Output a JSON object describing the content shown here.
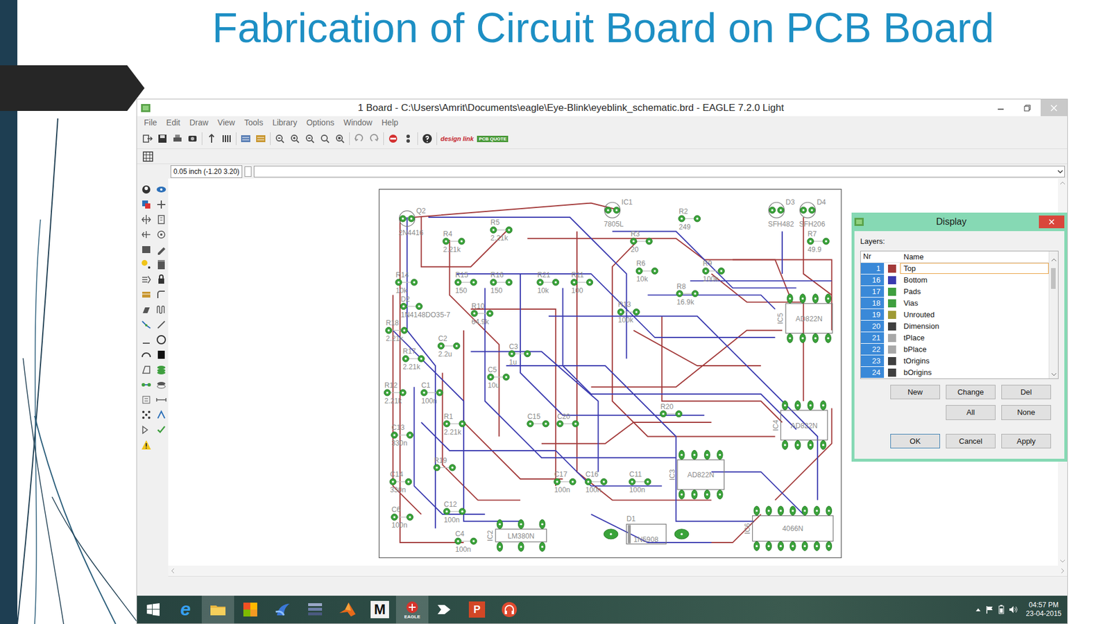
{
  "slide": {
    "title": "Fabrication of Circuit Board on PCB Board"
  },
  "window": {
    "title": "1 Board - C:\\Users\\Amrit\\Documents\\eagle\\Eye-Blink\\eyeblink_schematic.brd - EAGLE 7.2.0 Light"
  },
  "menu": [
    "File",
    "Edit",
    "Draw",
    "View",
    "Tools",
    "Library",
    "Options",
    "Window",
    "Help"
  ],
  "toolbar": {
    "logos": [
      "design link",
      "PCB QUOTE"
    ]
  },
  "command": {
    "coordinates": "0.05 inch (-1.20 3.20)"
  },
  "board": {
    "parts": [
      {
        "name": "Q2",
        "value": "2N4416",
        "kind": "round"
      },
      {
        "name": "IC1",
        "value": "7805L",
        "kind": "round"
      },
      {
        "name": "R2",
        "value": "249",
        "kind": "two-pad"
      },
      {
        "name": "D3",
        "value": "SFH482",
        "kind": "round"
      },
      {
        "name": "D4",
        "value": "SFH206",
        "kind": "round"
      },
      {
        "name": "R4",
        "value": "2.21k",
        "kind": "two-pad"
      },
      {
        "name": "R5",
        "value": "2.21k",
        "kind": "two-pad"
      },
      {
        "name": "R3",
        "value": "20",
        "kind": "two-pad"
      },
      {
        "name": "R7",
        "value": "49.9",
        "kind": "two-pad"
      },
      {
        "name": "R6",
        "value": "10k",
        "kind": "two-pad"
      },
      {
        "name": "R9",
        "value": "100k",
        "kind": "two-pad"
      },
      {
        "name": "R14",
        "value": "10k",
        "kind": "two-pad"
      },
      {
        "name": "R15",
        "value": "150",
        "kind": "two-pad"
      },
      {
        "name": "R16",
        "value": "150",
        "kind": "two-pad"
      },
      {
        "name": "R21",
        "value": "10k",
        "kind": "two-pad"
      },
      {
        "name": "R11",
        "value": "100",
        "kind": "two-pad"
      },
      {
        "name": "D2",
        "value": "1N4148DO35-7",
        "kind": "two-pad"
      },
      {
        "name": "R10",
        "value": "64.9k",
        "kind": "two-pad"
      },
      {
        "name": "R8",
        "value": "16.9k",
        "kind": "two-pad"
      },
      {
        "name": "R13",
        "value": "100k",
        "kind": "two-pad"
      },
      {
        "name": "IC5",
        "value": "AD822N",
        "kind": "dip"
      },
      {
        "name": "R18",
        "value": "2.21k",
        "kind": "two-pad"
      },
      {
        "name": "C2",
        "value": "2.2u",
        "kind": "two-pad"
      },
      {
        "name": "C3",
        "value": "1u",
        "kind": "two-pad"
      },
      {
        "name": "R17",
        "value": "2.21k",
        "kind": "two-pad"
      },
      {
        "name": "C5",
        "value": "10u",
        "kind": "two-pad"
      },
      {
        "name": "R12",
        "value": "2.21k",
        "kind": "two-pad"
      },
      {
        "name": "C1",
        "value": "100n",
        "kind": "two-pad"
      },
      {
        "name": "R20",
        "kind": "two-pad"
      },
      {
        "name": "IC4",
        "value": "AD822N",
        "kind": "dip"
      },
      {
        "name": "C13",
        "value": "330n",
        "kind": "two-pad"
      },
      {
        "name": "R1",
        "value": "2.21k",
        "kind": "two-pad"
      },
      {
        "name": "C15",
        "kind": "two-pad"
      },
      {
        "name": "C20",
        "kind": "two-pad"
      },
      {
        "name": "R19",
        "kind": "two-pad"
      },
      {
        "name": "C14",
        "value": "330n",
        "kind": "two-pad"
      },
      {
        "name": "C17",
        "value": "100n",
        "kind": "two-pad"
      },
      {
        "name": "C16",
        "value": "100n",
        "kind": "two-pad"
      },
      {
        "name": "C11",
        "value": "100n",
        "kind": "two-pad"
      },
      {
        "name": "IC3",
        "value": "AD822N",
        "kind": "dip"
      },
      {
        "name": "C6",
        "value": "100n",
        "kind": "two-pad"
      },
      {
        "name": "C12",
        "value": "100n",
        "kind": "two-pad"
      },
      {
        "name": "C4",
        "value": "100n",
        "kind": "two-pad"
      },
      {
        "name": "IC2",
        "value": "LM380N",
        "kind": "dip"
      },
      {
        "name": "D1",
        "value": "1N5908",
        "kind": "diode"
      },
      {
        "name": "IC6",
        "value": "4066N",
        "kind": "dip"
      }
    ]
  },
  "display": {
    "title": "Display",
    "layers_label": "Layers:",
    "columns": [
      "Nr",
      "Name"
    ],
    "layers": [
      {
        "nr": "1",
        "name": "Top",
        "color": "#a33a3a",
        "visible": true,
        "focused": true
      },
      {
        "nr": "16",
        "name": "Bottom",
        "color": "#3b3bb0",
        "visible": true,
        "focused": false
      },
      {
        "nr": "17",
        "name": "Pads",
        "color": "#3f9f3f",
        "visible": true,
        "focused": false
      },
      {
        "nr": "18",
        "name": "Vias",
        "color": "#3f9f3f",
        "visible": true,
        "focused": false
      },
      {
        "nr": "19",
        "name": "Unrouted",
        "color": "#9e9a35",
        "visible": true,
        "focused": false
      },
      {
        "nr": "20",
        "name": "Dimension",
        "color": "#404040",
        "visible": true,
        "focused": false
      },
      {
        "nr": "21",
        "name": "tPlace",
        "color": "#a8a8a8",
        "visible": true,
        "focused": false
      },
      {
        "nr": "22",
        "name": "bPlace",
        "color": "#a8a8a8",
        "visible": true,
        "focused": false
      },
      {
        "nr": "23",
        "name": "tOrigins",
        "color": "#404040",
        "visible": true,
        "focused": false
      },
      {
        "nr": "24",
        "name": "bOrigins",
        "color": "#404040",
        "visible": true,
        "focused": false
      }
    ],
    "buttons": [
      "New",
      "Change",
      "Del",
      "All",
      "None",
      "OK",
      "Cancel",
      "Apply"
    ]
  },
  "taskbar": {
    "apps": [
      {
        "kind": "ie",
        "label": "e",
        "selected": false
      },
      {
        "kind": "explorer",
        "selected": true
      },
      {
        "kind": "app-orange",
        "selected": false
      },
      {
        "kind": "app-blue",
        "selected": false
      },
      {
        "kind": "app-bars",
        "selected": false
      },
      {
        "kind": "matlab",
        "selected": false
      },
      {
        "kind": "mathcad",
        "label": "M",
        "selected": false
      },
      {
        "kind": "eagle",
        "label": "EAGLE",
        "selected": true
      },
      {
        "kind": "logic",
        "selected": false
      },
      {
        "kind": "powerpoint",
        "label": "P",
        "selected": false
      },
      {
        "kind": "music",
        "selected": false
      }
    ],
    "time": "04:57 PM",
    "date": "23-04-2015"
  }
}
